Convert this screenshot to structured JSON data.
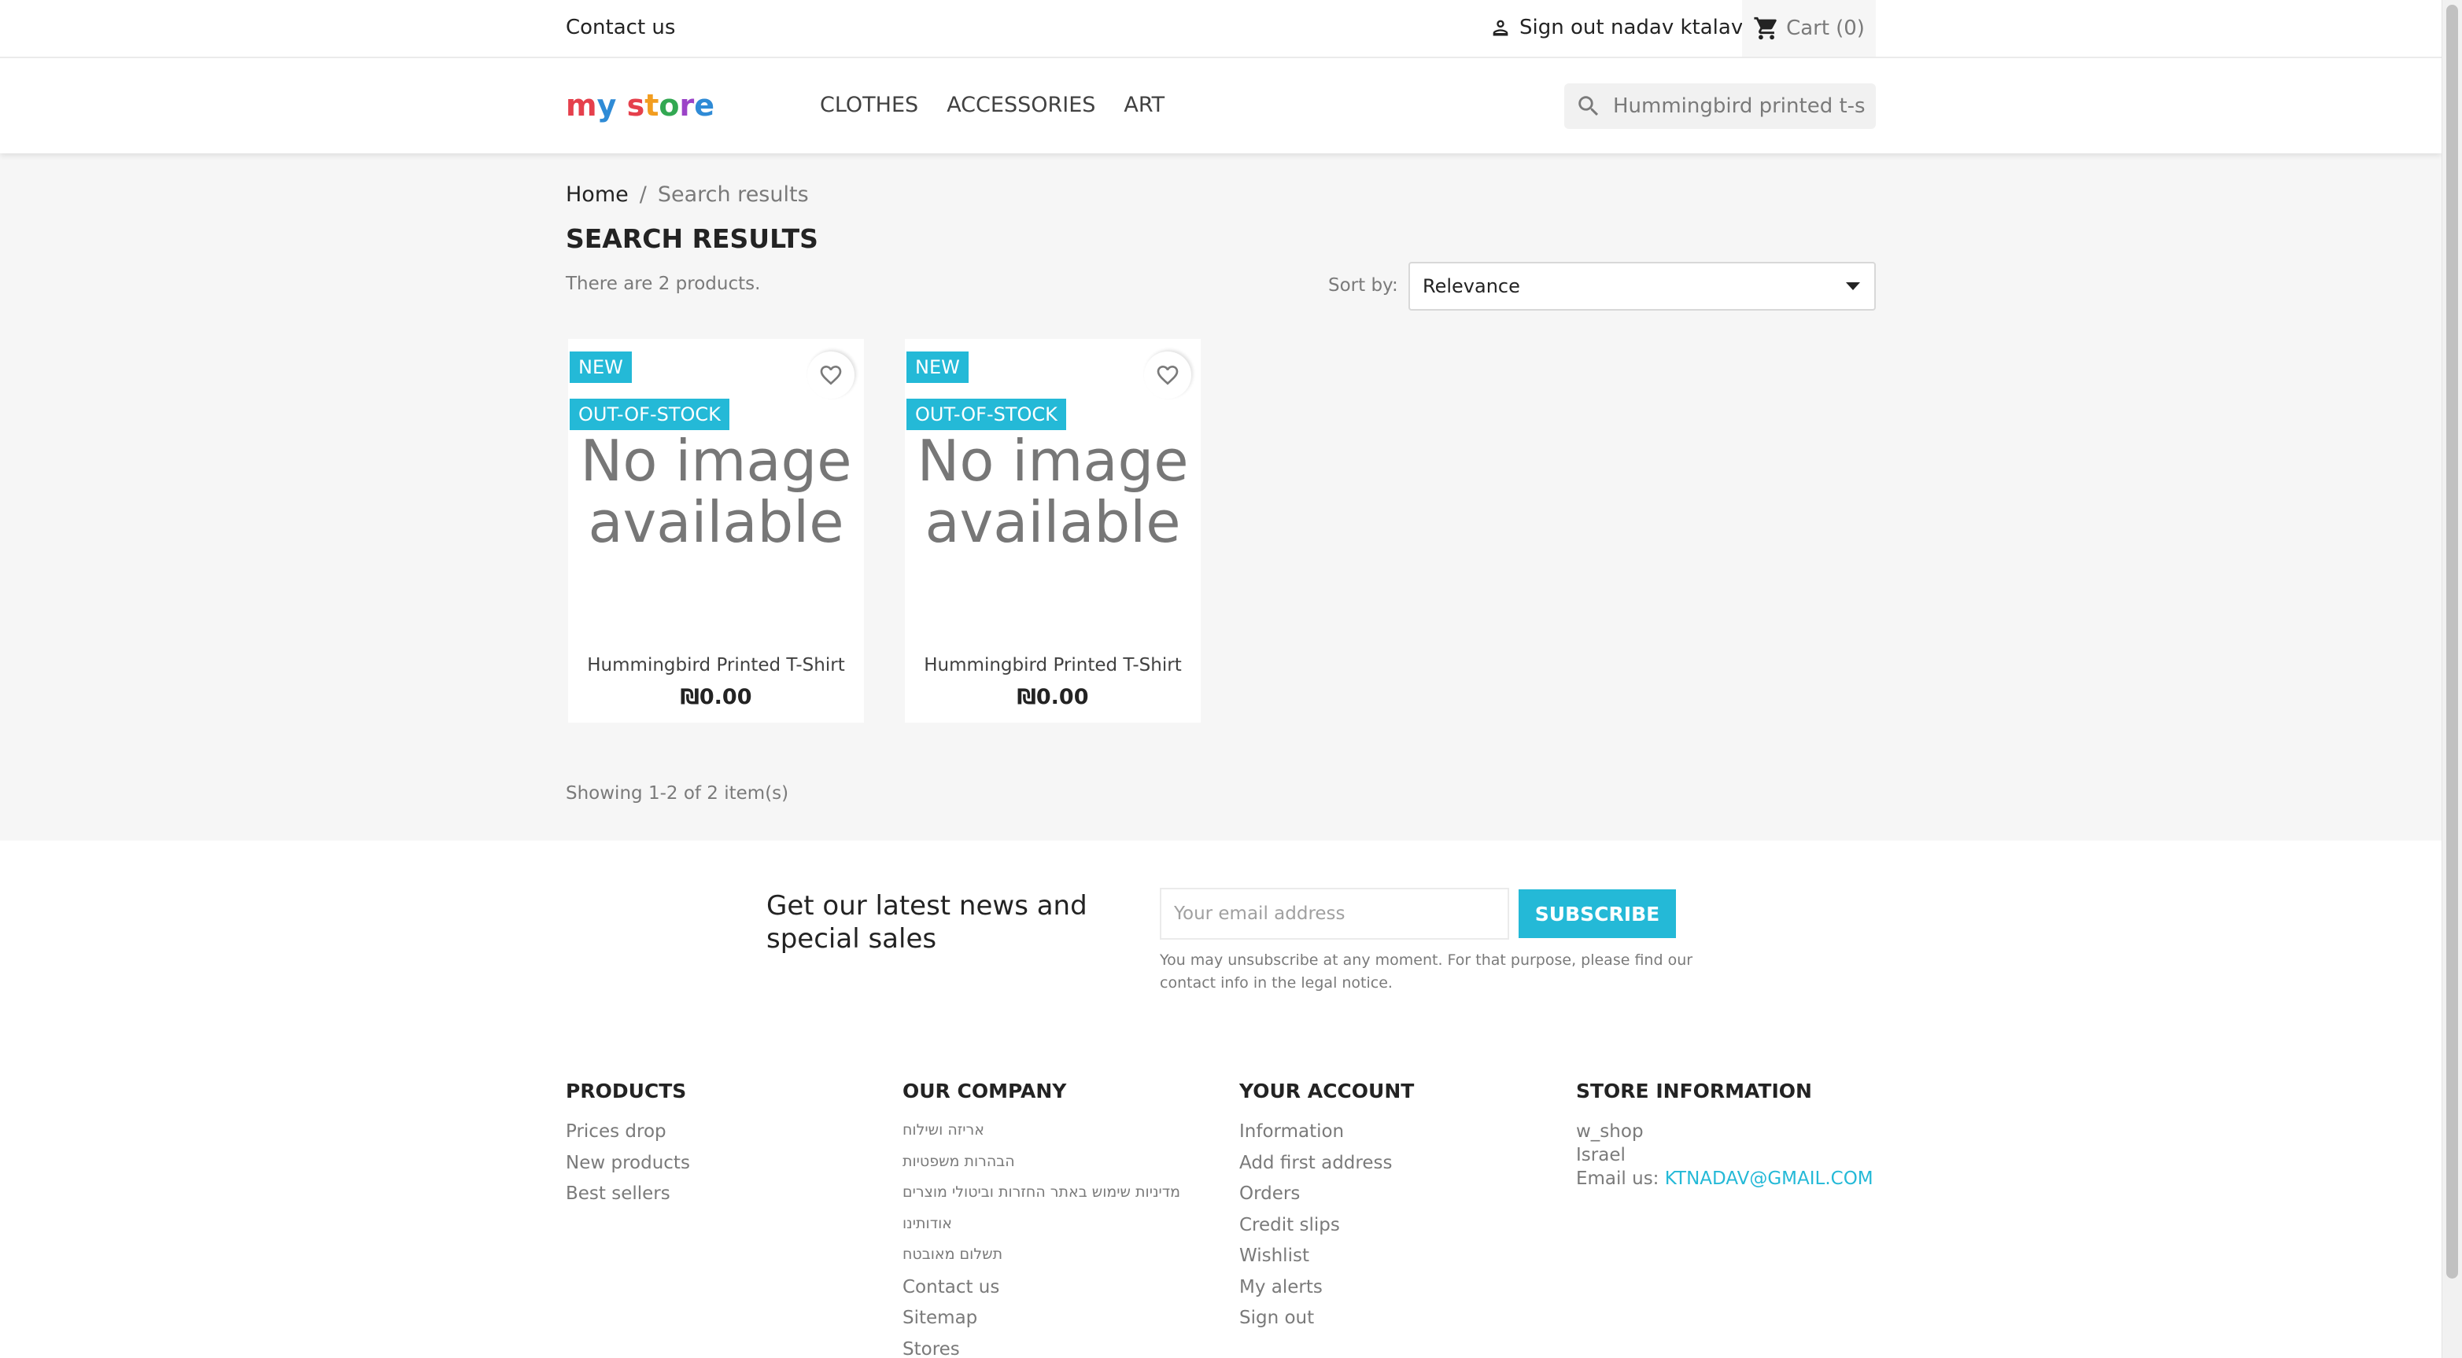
{
  "topbar": {
    "contact": "Contact us",
    "signout": "Sign out",
    "username": "nadav ktalav",
    "cart_label": "Cart",
    "cart_count": "(0)"
  },
  "header": {
    "logo": "my store",
    "menu": [
      "CLOTHES",
      "ACCESSORIES",
      "ART"
    ],
    "search_value": "Hummingbird printed t-shirt"
  },
  "breadcrumb": {
    "home": "Home",
    "separator": "/",
    "current": "Search results"
  },
  "results": {
    "title": "SEARCH RESULTS",
    "count_text": "There are 2 products.",
    "sort_label": "Sort by:",
    "sort_value": "Relevance",
    "showing": "Showing 1-2 of 2 item(s)"
  },
  "products": [
    {
      "badge_new": "NEW",
      "badge_oos": "OUT-OF-STOCK",
      "image_line1": "No image",
      "image_line2": "available",
      "name": "Hummingbird Printed T-Shirt",
      "price": "₪0.00"
    },
    {
      "badge_new": "NEW",
      "badge_oos": "OUT-OF-STOCK",
      "image_line1": "No image",
      "image_line2": "available",
      "name": "Hummingbird Printed T-Shirt",
      "price": "₪0.00"
    }
  ],
  "newsletter": {
    "title": "Get our latest news and special sales",
    "placeholder": "Your email address",
    "button": "SUBSCRIBE",
    "note": "You may unsubscribe at any moment. For that purpose, please find our contact info in the legal notice."
  },
  "footer": {
    "products": {
      "title": "PRODUCTS",
      "items": [
        "Prices drop",
        "New products",
        "Best sellers"
      ]
    },
    "company": {
      "title": "OUR COMPANY",
      "items": [
        "אריזה ושילוח",
        "הבהרות משפטיות",
        "מדיניות שימוש באתר החזרות וביטולי מוצרים",
        "אודותינו",
        "תשלום מאובטח",
        "Contact us",
        "Sitemap",
        "Stores"
      ]
    },
    "account": {
      "title": "YOUR ACCOUNT",
      "items": [
        "Information",
        "Add first address",
        "Orders",
        "Credit slips",
        "Wishlist",
        "My alerts",
        "Sign out"
      ]
    },
    "store": {
      "title": "STORE INFORMATION",
      "name": "w_shop",
      "country": "Israel",
      "email_label": "Email us:",
      "email": "KTNADAV@GMAIL.COM"
    }
  },
  "colors": {
    "accent": "#24b9d7",
    "background": "#f6f6f6"
  }
}
